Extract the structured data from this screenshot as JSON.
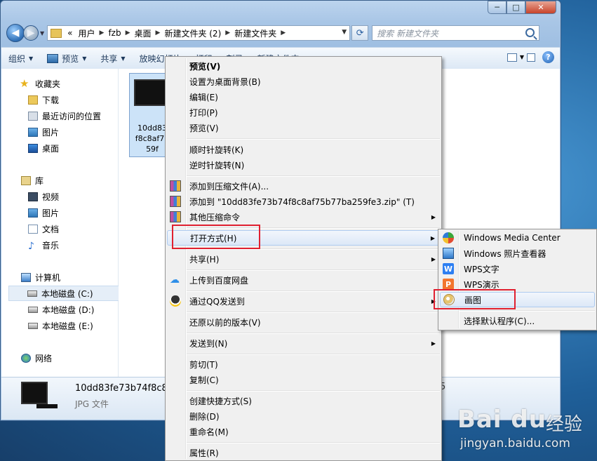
{
  "window": {
    "caption": {
      "minimize": "─",
      "maximize": "□",
      "close": "✕"
    }
  },
  "address": {
    "prefix": "«",
    "crumbs": [
      "用户",
      "fzb",
      "桌面",
      "新建文件夹 (2)",
      "新建文件夹"
    ],
    "search_placeholder": "搜索 新建文件夹"
  },
  "toolbar": {
    "organize": "组织",
    "preview": "预览",
    "share": "共享",
    "slideshow": "放映幻灯片",
    "print": "打印",
    "burn": "刻录",
    "new_folder": "新建文件夹"
  },
  "navpane": {
    "favorites": {
      "title": "收藏夹",
      "items": [
        "下载",
        "最近访问的位置",
        "图片",
        "桌面"
      ]
    },
    "libraries": {
      "title": "库",
      "items": [
        "视频",
        "图片",
        "文档",
        "音乐"
      ]
    },
    "computer": {
      "title": "计算机",
      "items": [
        "本地磁盘 (C:)",
        "本地磁盘 (D:)",
        "本地磁盘 (E:)"
      ]
    },
    "network": {
      "title": "网络"
    }
  },
  "file": {
    "thumb_lines": [
      "10dd83",
      "f8c8af75",
      "59f"
    ],
    "detail_name": "10dd83fe73b74f8c8",
    "detail_type": "JPG 文件",
    "detail_right": "5"
  },
  "context_menu": {
    "items": [
      {
        "label": "预览(V)",
        "bold": true
      },
      {
        "label": "设置为桌面背景(B)"
      },
      {
        "label": "编辑(E)"
      },
      {
        "label": "打印(P)"
      },
      {
        "label": "预览(V)"
      },
      {
        "label": "顺时针旋转(K)"
      },
      {
        "label": "逆时针旋转(N)"
      },
      {
        "label": "添加到压缩文件(A)...",
        "icon": "winrar-icon"
      },
      {
        "label": "添加到 \"10dd83fe73b74f8c8af75b77ba259fe3.zip\" (T)",
        "icon": "winrar-icon"
      },
      {
        "label": "其他压缩命令",
        "icon": "winrar-icon",
        "submenu": true
      },
      {
        "label": "打开方式(H)",
        "submenu": true,
        "highlighted": true
      },
      {
        "label": "共享(H)",
        "submenu": true
      },
      {
        "label": "上传到百度网盘",
        "icon": "baidu-netdisk-icon"
      },
      {
        "label": "通过QQ发送到",
        "icon": "qq-icon",
        "submenu": true
      },
      {
        "label": "还原以前的版本(V)"
      },
      {
        "label": "发送到(N)",
        "submenu": true
      },
      {
        "label": "剪切(T)"
      },
      {
        "label": "复制(C)"
      },
      {
        "label": "创建快捷方式(S)"
      },
      {
        "label": "删除(D)"
      },
      {
        "label": "重命名(M)"
      },
      {
        "label": "属性(R)"
      }
    ]
  },
  "open_with_menu": {
    "items": [
      {
        "label": "Windows Media Center",
        "icon": "windows-media-center-icon"
      },
      {
        "label": "Windows 照片查看器",
        "icon": "photo-viewer-icon"
      },
      {
        "label": "WPS文字",
        "icon": "wps-writer-icon"
      },
      {
        "label": "WPS演示",
        "icon": "wps-presentation-icon"
      },
      {
        "label": "画图",
        "icon": "paint-icon",
        "highlighted": true
      },
      {
        "label": "选择默认程序(C)..."
      }
    ]
  },
  "watermark": {
    "brand": "Bai du",
    "jingyan": "经验",
    "url": "jingyan.baidu.com"
  },
  "colors": {
    "highlight_box": "#e02030",
    "menu_bg": "#f0f0f0",
    "selection": "#cce3f8"
  }
}
